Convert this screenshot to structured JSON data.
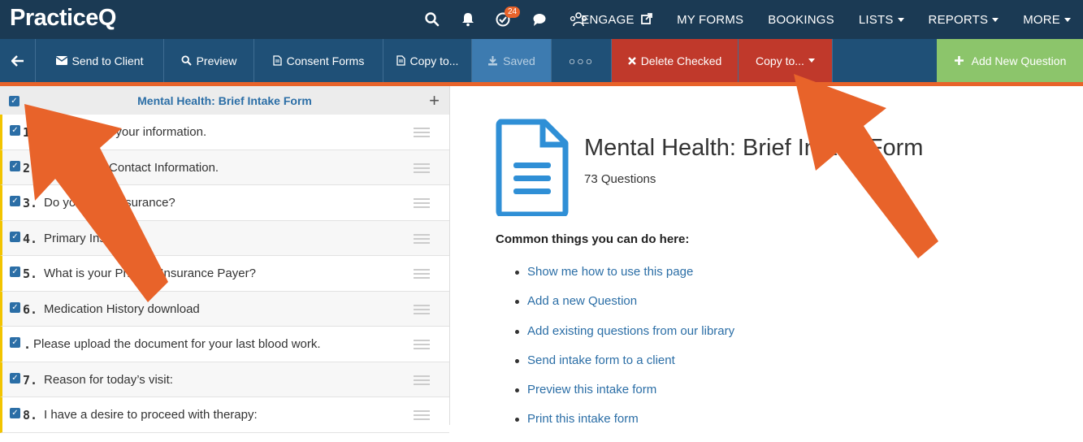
{
  "app": {
    "logo": "PracticeQ",
    "notification_badge": "24",
    "nav_links": [
      "ENGAGE",
      "MY FORMS",
      "BOOKINGS",
      "LISTS",
      "REPORTS",
      "MORE"
    ]
  },
  "toolbar": {
    "send_label": "Send to Client",
    "preview_label": "Preview",
    "consent_label": "Consent Forms",
    "copy_label": "Copy to...",
    "saved_label": "Saved",
    "more_label": "○○○",
    "delete_label": "Delete Checked",
    "copy2_label": "Copy to...",
    "add_label": "Add New Question"
  },
  "form": {
    "title": "Mental Health: Brief Intake Form",
    "count": "73 Questions",
    "questions": [
      {
        "num": "1.",
        "text": "Please enter your information."
      },
      {
        "num": "2.",
        "text": "Emergency Contact Information."
      },
      {
        "num": "3.",
        "text": "Do you have insurance?"
      },
      {
        "num": "4.",
        "text": "Primary Insurance"
      },
      {
        "num": "5.",
        "text": "What is your Primary Insurance Payer?"
      },
      {
        "num": "6.",
        "text": "Medication History download"
      },
      {
        "num": ".",
        "text": "Please upload the document for your last blood work."
      },
      {
        "num": "7.",
        "text": "Reason for today’s visit:"
      },
      {
        "num": "8.",
        "text": "I have a desire to proceed with therapy:"
      }
    ]
  },
  "help": {
    "heading": "Common things you can do here:",
    "links": [
      "Show me how to use this page",
      "Add a new Question",
      "Add existing questions from our library",
      "Send intake form to a client",
      "Preview this intake form",
      "Print this intake form"
    ]
  },
  "colors": {
    "nav_bg": "#1b3a54",
    "toolbar_bg": "#1f5077",
    "accent_orange": "#e8632a",
    "delete_red": "#c0392b",
    "add_green": "#8cc56b",
    "link_blue": "#2b6ea6"
  }
}
